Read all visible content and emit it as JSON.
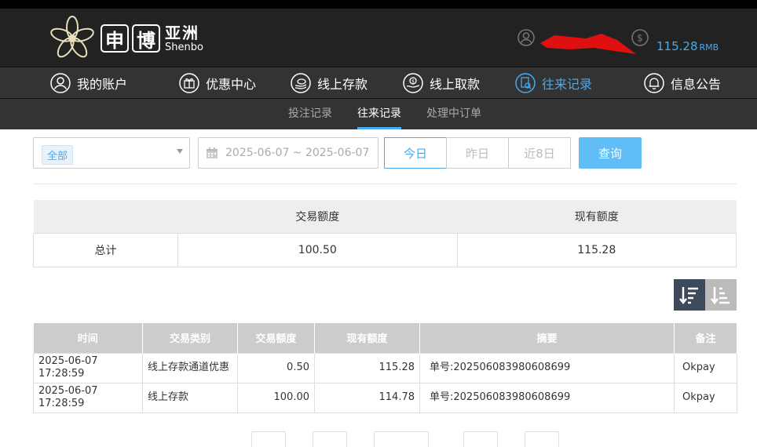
{
  "header": {
    "logo_chars": [
      "申",
      "博"
    ],
    "logo_cn": "亚洲",
    "logo_en": "Shenbo",
    "balance": "115.28",
    "balance_unit": "RMB"
  },
  "nav": [
    {
      "label": "我的账户",
      "icon": "user-circle-icon",
      "active": false
    },
    {
      "label": "优惠中心",
      "icon": "gift-icon",
      "active": false
    },
    {
      "label": "线上存款",
      "icon": "deposit-coin-icon",
      "active": false
    },
    {
      "label": "线上取款",
      "icon": "withdraw-hand-icon",
      "active": false
    },
    {
      "label": "往来记录",
      "icon": "record-icon",
      "active": true
    },
    {
      "label": "信息公告",
      "icon": "bell-icon",
      "active": false
    }
  ],
  "subnav": [
    {
      "label": "投注记录",
      "active": false
    },
    {
      "label": "往来记录",
      "active": true
    },
    {
      "label": "处理中订单",
      "active": false
    }
  ],
  "filters": {
    "type_tag": "全部",
    "date_range": "2025-06-07 ~ 2025-06-07",
    "quick": [
      "今日",
      "昨日",
      "近8日"
    ],
    "query": "查询"
  },
  "summary": {
    "headers": [
      "",
      "交易额度",
      "现有额度"
    ],
    "row": [
      "总计",
      "100.50",
      "115.28"
    ]
  },
  "records": {
    "headers": [
      "时间",
      "交易类别",
      "交易额度",
      "现有额度",
      "摘要",
      "备注"
    ],
    "rows": [
      [
        "2025-06-07 17:28:59",
        "线上存款通道优惠",
        "0.50",
        "115.28",
        "单号:202506083980608699",
        "Okpay"
      ],
      [
        "2025-06-07 17:28:59",
        "线上存款",
        "100.00",
        "114.78",
        "单号:202506083980608699",
        "Okpay"
      ]
    ]
  },
  "colors": {
    "accent": "#49a9ee",
    "header_bg": "#222222",
    "nav_bg": "#333333"
  }
}
